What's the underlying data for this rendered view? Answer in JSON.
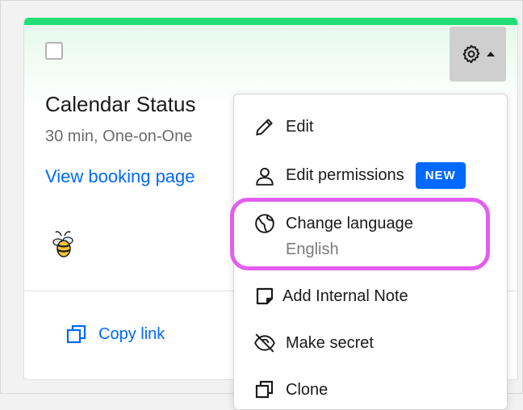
{
  "card": {
    "title": "Calendar Status",
    "subtitle": "30 min, One-on-One",
    "booking_link": "View booking page",
    "copy_link": "Copy link"
  },
  "menu": {
    "items": [
      {
        "label": "Edit",
        "icon": "pencil-icon"
      },
      {
        "label": "Edit permissions",
        "icon": "user-icon",
        "badge": "NEW"
      },
      {
        "label": "Change language",
        "icon": "globe-icon",
        "sublabel": "English"
      },
      {
        "label": "Add Internal Note",
        "icon": "note-icon"
      },
      {
        "label": "Make secret",
        "icon": "eye-off-icon"
      },
      {
        "label": "Clone",
        "icon": "clone-icon"
      }
    ]
  },
  "colors": {
    "accent": "#0069ff",
    "topbar": "#1ede74",
    "highlight": "#e35ef0"
  }
}
